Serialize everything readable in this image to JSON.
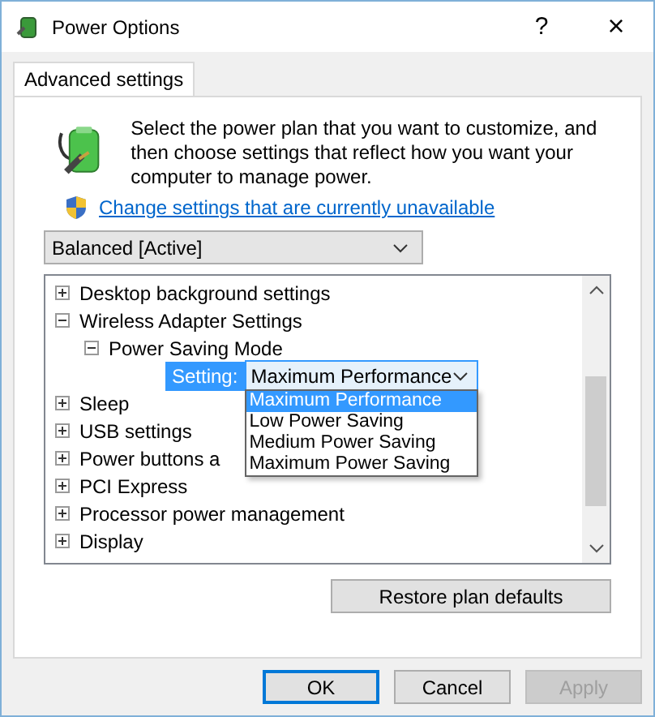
{
  "window": {
    "title": "Power Options",
    "help": "?",
    "close": "×"
  },
  "tabs": [
    {
      "label": "Advanced settings",
      "selected": true
    }
  ],
  "description": "Select the power plan that you want to customize, and then choose settings that reflect how you want your computer to manage power.",
  "link": "Change settings that are currently unavailable",
  "plan": {
    "value": "Balanced [Active]"
  },
  "tree": [
    {
      "kind": "node",
      "label": "Desktop background settings",
      "expanded": false
    },
    {
      "kind": "node",
      "label": "Wireless Adapter Settings",
      "expanded": true,
      "children": [
        {
          "kind": "node",
          "label": "Power Saving Mode",
          "expanded": true,
          "children": [
            {
              "kind": "setting",
              "label": "Setting:",
              "value": "Maximum Performance",
              "options": [
                {
                  "label": "Maximum Performance",
                  "selected": true
                },
                {
                  "label": "Low Power Saving",
                  "selected": false
                },
                {
                  "label": "Medium Power Saving",
                  "selected": false
                },
                {
                  "label": "Maximum Power Saving",
                  "selected": false
                }
              ]
            }
          ]
        }
      ]
    },
    {
      "kind": "node",
      "label": "Sleep",
      "expanded": false
    },
    {
      "kind": "node",
      "label": "USB settings",
      "expanded": false
    },
    {
      "kind": "node",
      "label": "Power buttons a",
      "expanded": false
    },
    {
      "kind": "node",
      "label": "PCI Express",
      "expanded": false
    },
    {
      "kind": "node",
      "label": "Processor power management",
      "expanded": false
    },
    {
      "kind": "node",
      "label": "Display",
      "expanded": false
    }
  ],
  "restore_button": "Restore plan defaults",
  "buttons": [
    {
      "label": "OK",
      "disabled": false,
      "default": true
    },
    {
      "label": "Cancel",
      "disabled": false,
      "default": false
    },
    {
      "label": "Apply",
      "disabled": true,
      "default": false
    }
  ]
}
